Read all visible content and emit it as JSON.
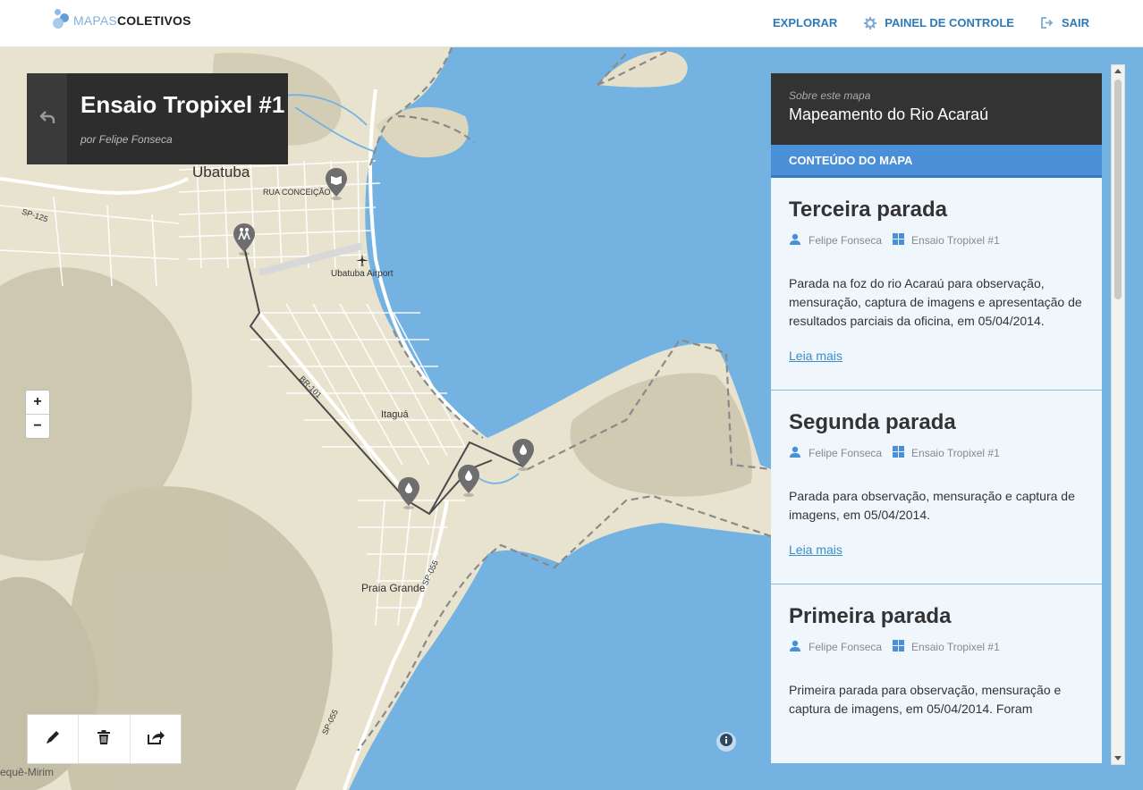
{
  "header": {
    "logo_light": "MAPAS",
    "logo_bold": "COLETIVOS",
    "nav": [
      {
        "label": "EXPLORAR"
      },
      {
        "label": "PAINEL DE CONTROLE"
      },
      {
        "label": "SAIR"
      }
    ]
  },
  "map_card": {
    "title": "Ensaio Tropixel #1",
    "author": "por Felipe Fonseca"
  },
  "map_labels": {
    "ubatuba": "Ubatuba",
    "rua": "RUA CONCEIÇÃO",
    "airport": "Ubatuba Airport",
    "sp125": "SP-125",
    "br101": "BR-101",
    "itagua": "Itaguá",
    "praia": "Praia Grande",
    "sp055a": "SP-055",
    "sp055b": "SP-055",
    "mirim": "equê-Mirim"
  },
  "zoom": {
    "in": "+",
    "out": "−"
  },
  "panel": {
    "subtitle": "Sobre este mapa",
    "title": "Mapeamento do Rio Acaraú",
    "tab": "CONTEÚDO DO MAPA",
    "entries": [
      {
        "title": "Terceira parada",
        "author": "Felipe Fonseca",
        "map": "Ensaio Tropixel #1",
        "text": "Parada na foz do rio Acaraú para observação, mensuração, captura de imagens e apresentação de resultados parciais da oficina, em 05/04/2014.",
        "link": "Leia mais"
      },
      {
        "title": "Segunda parada",
        "author": "Felipe Fonseca",
        "map": "Ensaio Tropixel #1",
        "text": "Parada para observação, mensuração e captura de imagens, em 05/04/2014.",
        "link": "Leia mais"
      },
      {
        "title": "Primeira parada",
        "author": "Felipe Fonseca",
        "map": "Ensaio Tropixel #1",
        "text": "Primeira parada para observação, mensuração e captura de imagens, em 05/04/2014. Foram",
        "link": ""
      }
    ]
  },
  "colors": {
    "accent": "#4a90d9",
    "nav": "#2e7ab8",
    "water": "#74b2e2",
    "land": "#e9e4d2",
    "dark": "#333333"
  }
}
